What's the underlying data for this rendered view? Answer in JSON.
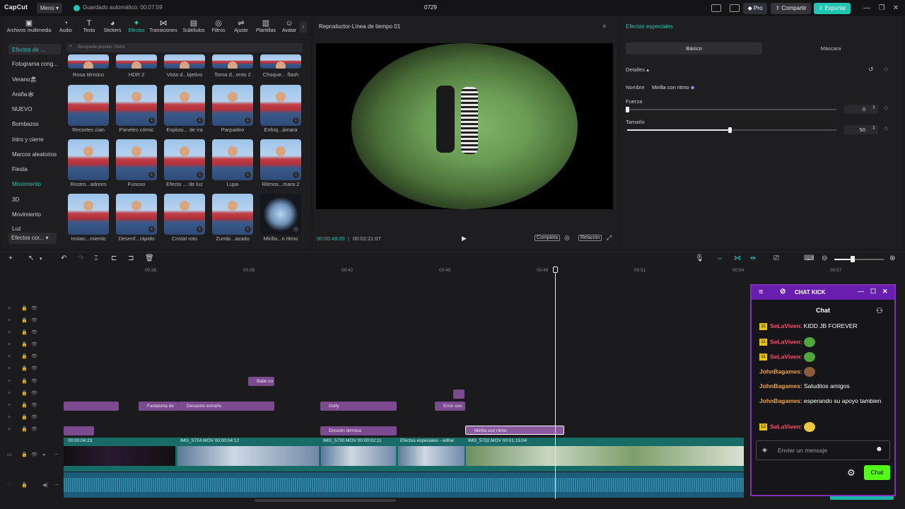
{
  "titlebar": {
    "logo": "CapCut",
    "menu": "Menú ▾",
    "autosave": "Guardado automático: 00:07:59",
    "project_title": "0729",
    "pro": "Pro",
    "share": "Compartir",
    "export": "Exportar"
  },
  "toolbar": {
    "items": [
      {
        "label": "Archivos multimedia",
        "icon": "media-icon"
      },
      {
        "label": "Audio",
        "icon": "audio-icon"
      },
      {
        "label": "Texto",
        "icon": "text-icon"
      },
      {
        "label": "Stickers",
        "icon": "sticker-icon"
      },
      {
        "label": "Efectos",
        "icon": "effects-icon",
        "active": true
      },
      {
        "label": "Transiciones",
        "icon": "transitions-icon"
      },
      {
        "label": "Subtítulos",
        "icon": "subtitles-icon"
      },
      {
        "label": "Filtros",
        "icon": "filters-icon"
      },
      {
        "label": "Ajuste",
        "icon": "adjust-icon"
      },
      {
        "label": "Plantillas",
        "icon": "templates-icon"
      },
      {
        "label": "Avatar",
        "icon": "avatar-icon"
      }
    ]
  },
  "categories": {
    "active": "Efectos de ...",
    "items": [
      "Fotograma cong...",
      "Verano🏖",
      "Araña🕸",
      "NUEVO",
      "Bombazos",
      "Intro y cierre",
      "Marcos aleatorios",
      "Fiesta",
      "Movimiento",
      "3D",
      "Movimiento",
      "Luz"
    ],
    "bottom": "Efectos cor... ▾"
  },
  "search": {
    "placeholder": "Búsqueda popular: Retro"
  },
  "effects": {
    "row0": [
      "Rosa térmico",
      "HDR 2",
      "Vista d...bjetivo",
      "Toma d...ento 2",
      "Choque... flash"
    ],
    "row1": [
      "Recortes cian",
      "Paneles cómic",
      "Explosi... de ira",
      "Parpadeo",
      "Enfoq...ámara"
    ],
    "row2": [
      "Rostro...adores",
      "Furioso",
      "Efecto ... de luz",
      "Lupa",
      "Ritmos...mara 2"
    ],
    "row3": [
      "Instan...miento",
      "Desenf...rápido",
      "Cristal roto",
      "Zumbi...azado",
      "Mirilla...n ritmo"
    ]
  },
  "player": {
    "title": "Reproductor-Línea de tiempo 01",
    "current_time": "00:00:48:20",
    "total_time": "00:02:21:07",
    "btn_full": "Completa",
    "btn_ratio": "Relación"
  },
  "right_panel": {
    "title": "Efectos especiales",
    "tab_basic": "Básico",
    "tab_mask": "Máscara",
    "details": "Detalles",
    "name_label": "Nombre",
    "name_value": "Mirilla con ritmo",
    "strength_label": "Fuerza",
    "strength_value": "0",
    "size_label": "Tamaño",
    "size_value": "50"
  },
  "ruler": {
    "ticks": [
      "00:36",
      "00:39",
      "00:42",
      "00:45",
      "00:48",
      "00:51",
      "00:54",
      "00:57"
    ]
  },
  "clips": [
    {
      "label": "Baile co",
      "row": 6
    },
    {
      "label": "",
      "row": 7
    },
    {
      "label": "",
      "row": 8
    },
    {
      "label": "Fantasma de",
      "row": 8
    },
    {
      "label": "Desastre extraño",
      "row": 8
    },
    {
      "label": "Dolly",
      "row": 8
    },
    {
      "label": "Error con",
      "row": 8
    },
    {
      "label": "",
      "row": 10
    },
    {
      "label": "División térmica",
      "row": 10
    },
    {
      "label": "Mirilla con ritmo",
      "row": 10,
      "selected": true
    }
  ],
  "video_labels": [
    "00:00:04:23",
    "IMG_5724.MOV  00:00:04:12",
    "IMG_5730.MOV  00:00:02:11",
    "Efectos especiales - editar",
    "IMG_5732.MOV  00:01:15:04"
  ],
  "chat": {
    "title": "CHAT KICK",
    "subtitle": "Chat",
    "messages": [
      {
        "badge": "11",
        "user": "SeLaViven",
        "text": "KIDD JB FOREVER",
        "color": "red"
      },
      {
        "badge": "11",
        "user": "SeLaViven",
        "text": "",
        "color": "red",
        "emoji": true
      },
      {
        "badge": "11",
        "user": "SeLaViven",
        "text": "",
        "color": "red",
        "emoji": true
      },
      {
        "badge": "",
        "user": "JohnBagames",
        "text": "",
        "color": "orange",
        "emoji": true
      },
      {
        "badge": "",
        "user": "JohnBagames",
        "text": "Saluditos amigos",
        "color": "orange"
      },
      {
        "badge": "",
        "user": "JohnBagames",
        "text": "esperando su apoyo tambien",
        "color": "orange"
      },
      {
        "badge": "12",
        "user": "SeLaViven",
        "text": "",
        "color": "red",
        "emoji": true
      }
    ],
    "input_placeholder": "Enviar un mensaje",
    "send": "Chat"
  }
}
